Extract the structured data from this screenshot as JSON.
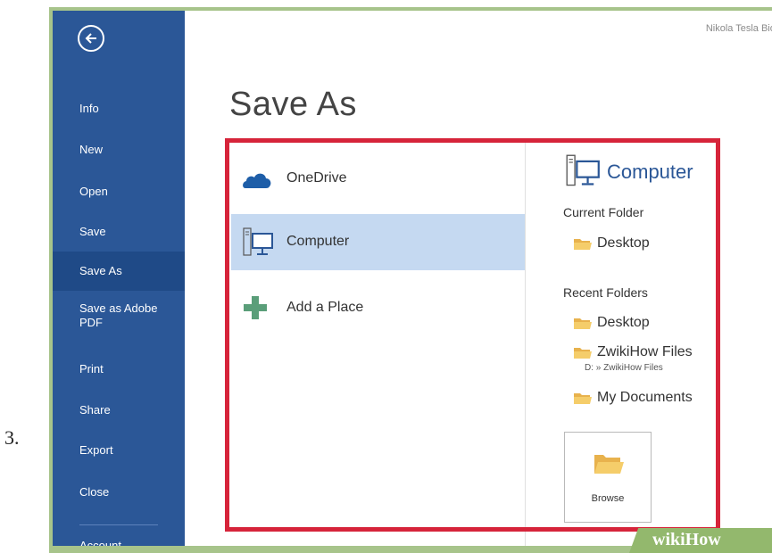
{
  "step_number": "3.",
  "document_name": "Nikola Tesla Biog",
  "back_icon": "back-arrow-icon",
  "sidebar": {
    "items": [
      {
        "label": "Info"
      },
      {
        "label": "New"
      },
      {
        "label": "Open"
      },
      {
        "label": "Save"
      },
      {
        "label": "Save As",
        "selected": true
      },
      {
        "label": "Save as Adobe PDF"
      },
      {
        "label": "Print"
      },
      {
        "label": "Share"
      },
      {
        "label": "Export"
      },
      {
        "label": "Close"
      },
      {
        "label": "Account"
      }
    ]
  },
  "page_title": "Save As",
  "places": [
    {
      "label": "OneDrive",
      "icon": "cloud-icon"
    },
    {
      "label": "Computer",
      "icon": "computer-icon",
      "selected": true
    },
    {
      "label": "Add a Place",
      "icon": "plus-icon"
    }
  ],
  "panel": {
    "title": "Computer",
    "title_icon": "computer-icon",
    "current_folder_heading": "Current Folder",
    "current_folder": {
      "name": "Desktop",
      "icon": "folder-icon"
    },
    "recent_folders_heading": "Recent Folders",
    "recent_folders": [
      {
        "name": "Desktop",
        "path": "",
        "icon": "folder-icon"
      },
      {
        "name": "ZwikiHow Files",
        "path": "D: » ZwikiHow Files",
        "icon": "folder-icon"
      },
      {
        "name": "My Documents",
        "path": "",
        "icon": "folder-icon"
      }
    ],
    "browse_label": "Browse",
    "browse_icon": "open-folder-icon"
  },
  "watermark": "wikiHow",
  "colors": {
    "sidebar": "#2b5797",
    "sidebar_selected": "#1f4a87",
    "highlight_border": "#d6243a",
    "selected_place": "#c5d9f1",
    "accent_text": "#2b5797",
    "frame": "#a7c48b"
  }
}
